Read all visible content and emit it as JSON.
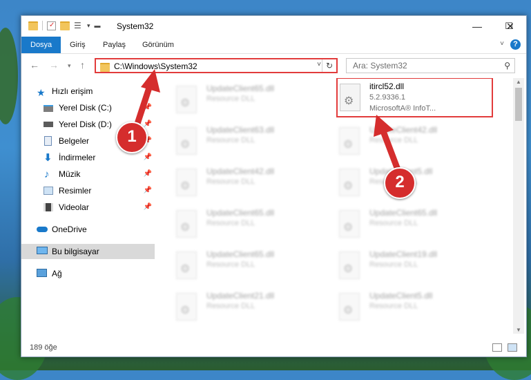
{
  "window": {
    "title": "System32",
    "controls": {
      "minimize": "—",
      "maximize": "☐",
      "close": "✕"
    }
  },
  "ribbon": {
    "tabs": [
      "Dosya",
      "Giriş",
      "Paylaş",
      "Görünüm"
    ],
    "help": "?"
  },
  "address_bar": {
    "path": "C:\\Windows\\System32"
  },
  "search": {
    "placeholder": "Ara: System32"
  },
  "sidebar": {
    "items": [
      {
        "label": "Hızlı erişim",
        "icon": "star-icon"
      },
      {
        "label": "Yerel Disk (C:)",
        "icon": "drive-icon",
        "pinned": true
      },
      {
        "label": "Yerel Disk (D:)",
        "icon": "drive-icon",
        "pinned": true
      },
      {
        "label": "Belgeler",
        "icon": "documents-icon",
        "pinned": true
      },
      {
        "label": "İndirmeler",
        "icon": "download-icon",
        "pinned": true
      },
      {
        "label": "Müzik",
        "icon": "music-icon",
        "pinned": true
      },
      {
        "label": "Resimler",
        "icon": "pictures-icon",
        "pinned": true
      },
      {
        "label": "Videolar",
        "icon": "videos-icon",
        "pinned": true
      },
      {
        "label": "OneDrive",
        "icon": "cloud-icon"
      },
      {
        "label": "Bu bilgisayar",
        "icon": "computer-icon",
        "selected": true
      },
      {
        "label": "Ağ",
        "icon": "network-icon"
      }
    ]
  },
  "files": {
    "left_column": [
      {
        "name": "UpdateClient65.dll",
        "type": "Resource DLL"
      },
      {
        "name": "UpdateClient63.dll",
        "type": "Resource DLL"
      },
      {
        "name": "UpdateClient42.dll",
        "type": "Resource DLL"
      },
      {
        "name": "UpdateClient65.dll",
        "type": "Resource DLL"
      },
      {
        "name": "UpdateClient65.dll",
        "type": "Resource DLL"
      },
      {
        "name": "UpdateClient21.dll",
        "type": "Resource DLL"
      }
    ],
    "highlighted": {
      "name": "itircl52.dll",
      "version": "5.2.9336.1",
      "company": "MicrosoftA® InfoT..."
    },
    "right_column": [
      {
        "name": "UpdateClient42.dll",
        "type": "Resource DLL"
      },
      {
        "name": "UpdateClient5.dll",
        "type": "Resource DLL"
      },
      {
        "name": "UpdateClient65.dll",
        "type": "Resource DLL"
      },
      {
        "name": "UpdateClient19.dll",
        "type": "Resource DLL"
      },
      {
        "name": "UpdateClient5.dll",
        "type": "Resource DLL"
      }
    ]
  },
  "status": {
    "item_count": "189 öğe"
  },
  "annotations": {
    "step1": "1",
    "step2": "2",
    "color": "#d52d2d"
  }
}
